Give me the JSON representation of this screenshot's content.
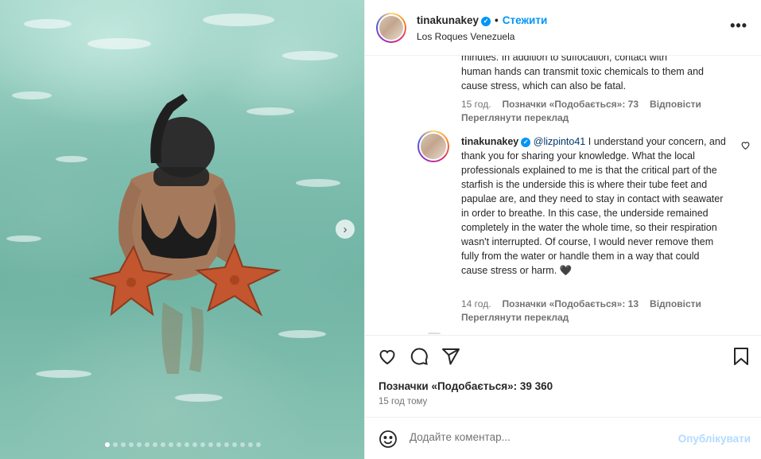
{
  "post": {
    "username": "tinakunakey",
    "follow_label": "Стежити",
    "location": "Los Roques Venezuela",
    "more_icon": "more-horizontal-icon"
  },
  "comments": {
    "first": {
      "text_line_partial": "minutes. In addition to suffocation, contact with",
      "text_rest": "human hands can transmit toxic chemicals to them and cause stress, which can also be fatal.",
      "time": "15 год.",
      "likes": "Позначки «Подобається»: 73",
      "reply": "Відповісти",
      "translate": "Переглянути переклад"
    },
    "second": {
      "username": "tinakunakey",
      "mention": "@lizpinto41",
      "text": "I understand your concern, and thank you for sharing your knowledge. What the local professionals explained to me is that the critical part of the starfish is the underside this is where their tube feet and papulae are, and they need to stay in contact with seawater in order to breathe. In this case, the underside remained completely in the water the whole time, so their respiration wasn't interrupted. Of course, I would never remove them fully from the water or handle them in a way that could cause stress or harm. 🖤",
      "time": "14 год.",
      "likes": "Позначки «Подобається»: 13",
      "reply": "Відповісти",
      "translate": "Переглянути переклад"
    }
  },
  "actions": {
    "likes_text": "Позначки «Подобається»: 39 360",
    "posted_ago": "15 год тому"
  },
  "composer": {
    "placeholder": "Додайте коментар...",
    "publish_label": "Опублікувати"
  },
  "carousel": {
    "dot_count": 20,
    "active_index": 0
  },
  "colors": {
    "accent_blue": "#0095f6",
    "publish_disabled": "#b3dbff",
    "starfish": "#c3552f",
    "water": "#7fbfb0"
  }
}
